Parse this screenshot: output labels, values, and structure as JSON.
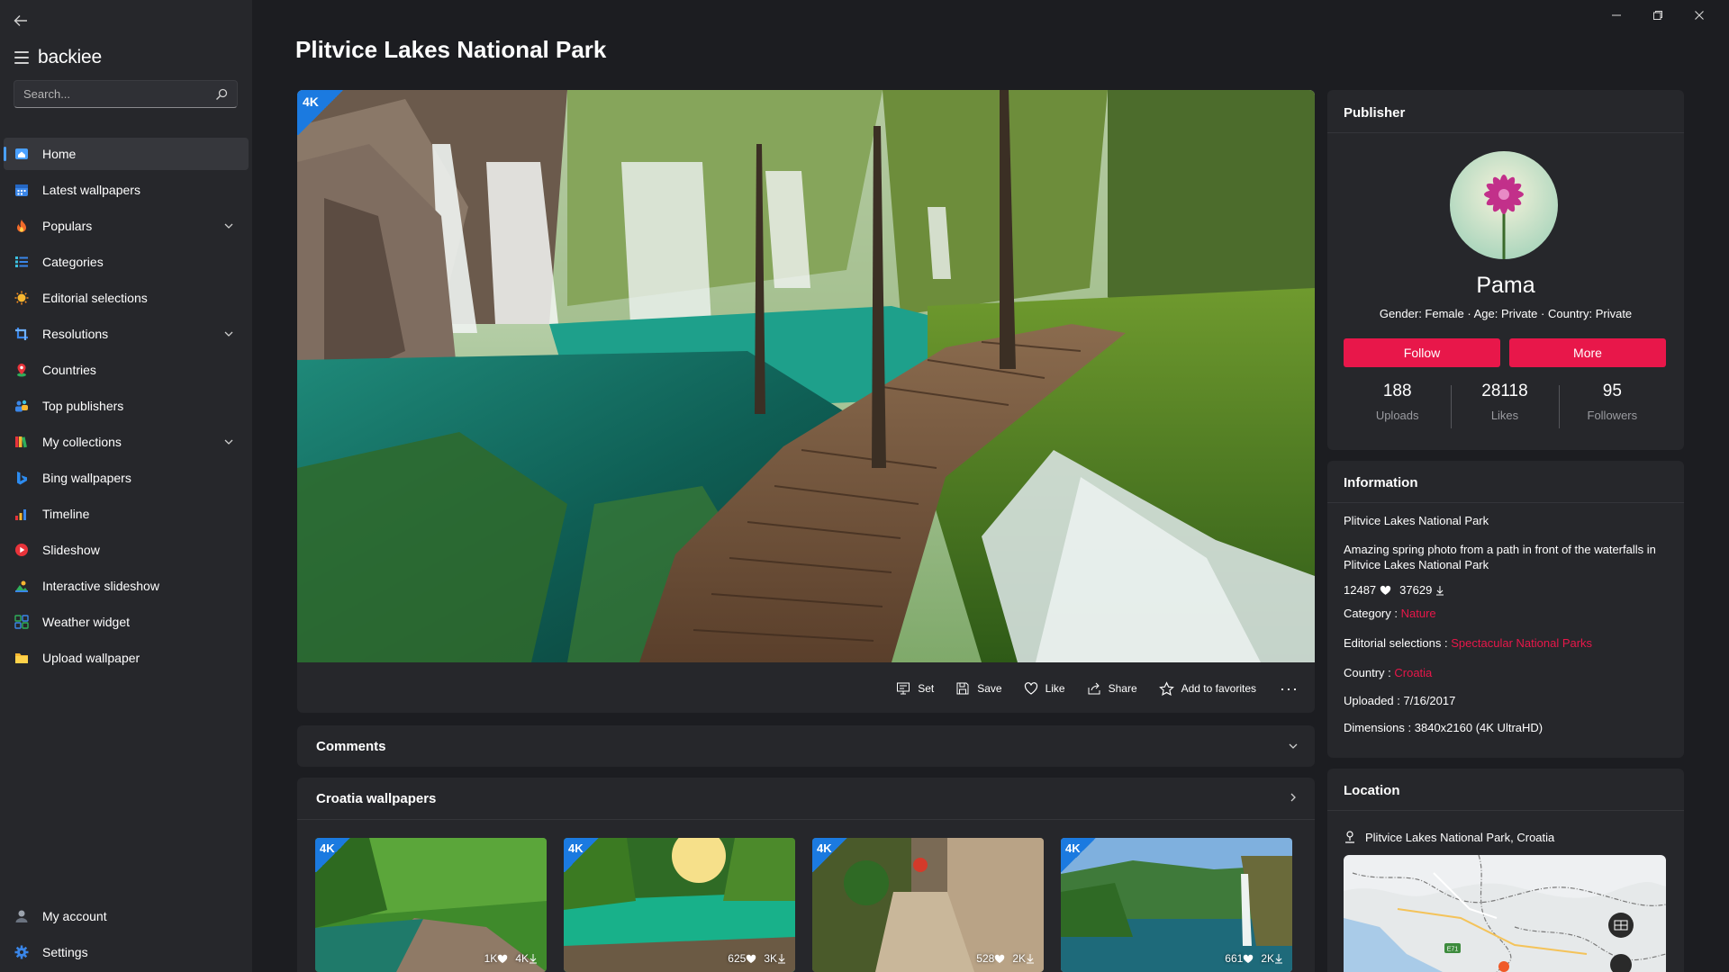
{
  "sidebar": {
    "brand": "backiee",
    "search_placeholder": "Search...",
    "items": [
      {
        "label": "Home",
        "icon": "home-icon"
      },
      {
        "label": "Latest wallpapers",
        "icon": "calendar-icon"
      },
      {
        "label": "Populars",
        "icon": "fire-icon"
      },
      {
        "label": "Categories",
        "icon": "list-icon"
      },
      {
        "label": "Editorial selections",
        "icon": "sun-icon"
      },
      {
        "label": "Resolutions",
        "icon": "crop-icon"
      },
      {
        "label": "Countries",
        "icon": "pin-icon"
      },
      {
        "label": "Top publishers",
        "icon": "people-icon"
      },
      {
        "label": "My collections",
        "icon": "books-icon"
      },
      {
        "label": "Bing wallpapers",
        "icon": "bing-icon"
      },
      {
        "label": "Timeline",
        "icon": "bar-chart-icon"
      },
      {
        "label": "Slideshow",
        "icon": "play-icon"
      },
      {
        "label": "Interactive slideshow",
        "icon": "landscape-icon"
      },
      {
        "label": "Weather widget",
        "icon": "grid-icon"
      },
      {
        "label": "Upload wallpaper",
        "icon": "folder-icon"
      }
    ],
    "bottom_items": [
      {
        "label": "My account",
        "icon": "account-icon"
      },
      {
        "label": "Settings",
        "icon": "gear-icon"
      }
    ]
  },
  "page": {
    "title": "Plitvice Lakes National Park",
    "badge": "4K"
  },
  "actions": {
    "set": "Set",
    "save": "Save",
    "like": "Like",
    "share": "Share",
    "favorites": "Add to favorites",
    "more": "···"
  },
  "comments": {
    "title": "Comments"
  },
  "croatia": {
    "title": "Croatia wallpapers",
    "thumbs": [
      {
        "badge": "4K",
        "likes": "1K",
        "downloads": "4K"
      },
      {
        "badge": "4K",
        "likes": "625",
        "downloads": "3K"
      },
      {
        "badge": "4K",
        "likes": "528",
        "downloads": "2K"
      },
      {
        "badge": "4K",
        "likes": "661",
        "downloads": "2K"
      }
    ]
  },
  "publisher": {
    "title": "Publisher",
    "name": "Pama",
    "meta": "Gender: Female · Age: Private · Country: Private",
    "follow": "Follow",
    "more": "More",
    "stats": [
      {
        "value": "188",
        "label": "Uploads"
      },
      {
        "value": "28118",
        "label": "Likes"
      },
      {
        "value": "95",
        "label": "Followers"
      }
    ]
  },
  "information": {
    "title": "Information",
    "name": "Plitvice Lakes National Park",
    "description": "Amazing spring photo from a path in front of the waterfalls in Plitvice Lakes National Park",
    "likes": "12487",
    "downloads": "37629",
    "category_label": "Category :",
    "category": "Nature",
    "editorial_label": "Editorial selections :",
    "editorial": "Spectacular National Parks",
    "country_label": "Country :",
    "country": "Croatia",
    "uploaded_label": "Uploaded :",
    "uploaded": "7/16/2017",
    "dimensions_label": "Dimensions :",
    "dimensions": "3840x2160 (4K UltraHD)"
  },
  "location": {
    "title": "Location",
    "place": "Plitvice Lakes National Park, Croatia",
    "map_label": "E71"
  },
  "colors": {
    "accent": "#e8174a",
    "badge": "#1b7ae0",
    "background": "#1c1d21",
    "card": "#26272b"
  }
}
